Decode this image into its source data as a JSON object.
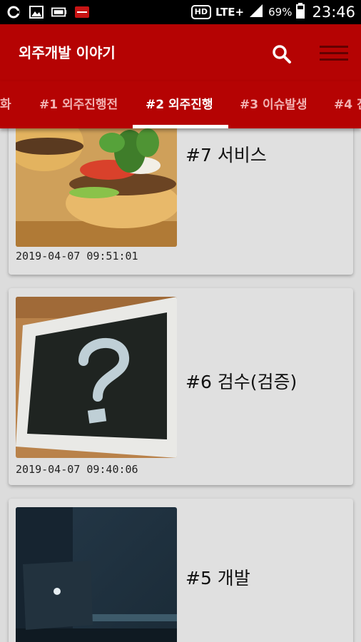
{
  "status_bar": {
    "left_icons": [
      "sync-icon",
      "gallery-icon",
      "battery-saver-icon",
      "app-notification-icon"
    ],
    "hd_label": "HD",
    "network_label": "LTE+",
    "battery_percent": "69%",
    "time": "23:46"
  },
  "app_bar": {
    "title": "외주개발 이야기",
    "search_icon": "search-icon",
    "menu_icon": "menu-icon"
  },
  "tabs": [
    {
      "label": "화",
      "active": false
    },
    {
      "label": "#1 외주진행전",
      "active": false
    },
    {
      "label": "#2 외주진행",
      "active": true
    },
    {
      "label": "#3 이슈발생",
      "active": false
    },
    {
      "label": "#4 진",
      "active": false
    }
  ],
  "posts": [
    {
      "title": "#7 서비스",
      "date": "2019-04-07 09:51:01",
      "thumbnail": "burger-photo"
    },
    {
      "title": "#6 검수(검증)",
      "date": "2019-04-07 09:40:06",
      "thumbnail": "question-mark-chalkboard-photo"
    },
    {
      "title": "#5 개발",
      "date": "",
      "thumbnail": "laptop-dark-room-photo"
    }
  ],
  "colors": {
    "primary": "#b50303",
    "tab_inactive_text": "#f2b3b3",
    "background": "#dcdcdc",
    "card": "#e0e0e0"
  }
}
